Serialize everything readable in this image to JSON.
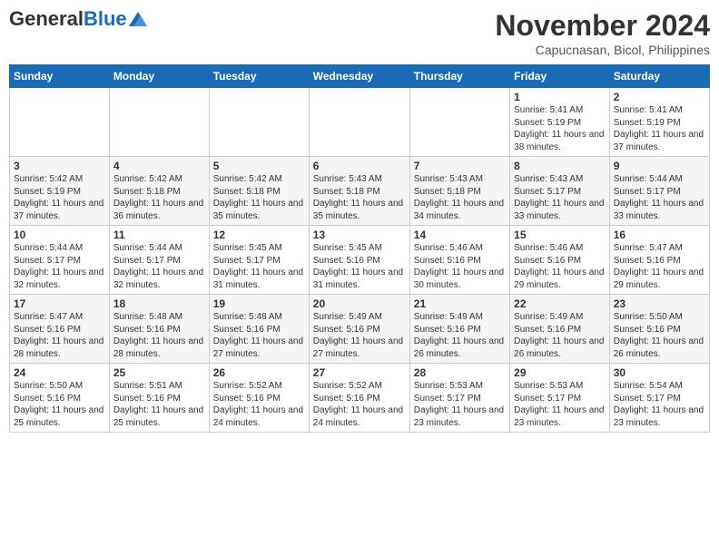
{
  "logo": {
    "general": "General",
    "blue": "Blue"
  },
  "title": "November 2024",
  "subtitle": "Capucnasan, Bicol, Philippines",
  "headers": [
    "Sunday",
    "Monday",
    "Tuesday",
    "Wednesday",
    "Thursday",
    "Friday",
    "Saturday"
  ],
  "weeks": [
    [
      {
        "day": "",
        "info": ""
      },
      {
        "day": "",
        "info": ""
      },
      {
        "day": "",
        "info": ""
      },
      {
        "day": "",
        "info": ""
      },
      {
        "day": "",
        "info": ""
      },
      {
        "day": "1",
        "info": "Sunrise: 5:41 AM\nSunset: 5:19 PM\nDaylight: 11 hours and 38 minutes."
      },
      {
        "day": "2",
        "info": "Sunrise: 5:41 AM\nSunset: 5:19 PM\nDaylight: 11 hours and 37 minutes."
      }
    ],
    [
      {
        "day": "3",
        "info": "Sunrise: 5:42 AM\nSunset: 5:19 PM\nDaylight: 11 hours and 37 minutes."
      },
      {
        "day": "4",
        "info": "Sunrise: 5:42 AM\nSunset: 5:18 PM\nDaylight: 11 hours and 36 minutes."
      },
      {
        "day": "5",
        "info": "Sunrise: 5:42 AM\nSunset: 5:18 PM\nDaylight: 11 hours and 35 minutes."
      },
      {
        "day": "6",
        "info": "Sunrise: 5:43 AM\nSunset: 5:18 PM\nDaylight: 11 hours and 35 minutes."
      },
      {
        "day": "7",
        "info": "Sunrise: 5:43 AM\nSunset: 5:18 PM\nDaylight: 11 hours and 34 minutes."
      },
      {
        "day": "8",
        "info": "Sunrise: 5:43 AM\nSunset: 5:17 PM\nDaylight: 11 hours and 33 minutes."
      },
      {
        "day": "9",
        "info": "Sunrise: 5:44 AM\nSunset: 5:17 PM\nDaylight: 11 hours and 33 minutes."
      }
    ],
    [
      {
        "day": "10",
        "info": "Sunrise: 5:44 AM\nSunset: 5:17 PM\nDaylight: 11 hours and 32 minutes."
      },
      {
        "day": "11",
        "info": "Sunrise: 5:44 AM\nSunset: 5:17 PM\nDaylight: 11 hours and 32 minutes."
      },
      {
        "day": "12",
        "info": "Sunrise: 5:45 AM\nSunset: 5:17 PM\nDaylight: 11 hours and 31 minutes."
      },
      {
        "day": "13",
        "info": "Sunrise: 5:45 AM\nSunset: 5:16 PM\nDaylight: 11 hours and 31 minutes."
      },
      {
        "day": "14",
        "info": "Sunrise: 5:46 AM\nSunset: 5:16 PM\nDaylight: 11 hours and 30 minutes."
      },
      {
        "day": "15",
        "info": "Sunrise: 5:46 AM\nSunset: 5:16 PM\nDaylight: 11 hours and 29 minutes."
      },
      {
        "day": "16",
        "info": "Sunrise: 5:47 AM\nSunset: 5:16 PM\nDaylight: 11 hours and 29 minutes."
      }
    ],
    [
      {
        "day": "17",
        "info": "Sunrise: 5:47 AM\nSunset: 5:16 PM\nDaylight: 11 hours and 28 minutes."
      },
      {
        "day": "18",
        "info": "Sunrise: 5:48 AM\nSunset: 5:16 PM\nDaylight: 11 hours and 28 minutes."
      },
      {
        "day": "19",
        "info": "Sunrise: 5:48 AM\nSunset: 5:16 PM\nDaylight: 11 hours and 27 minutes."
      },
      {
        "day": "20",
        "info": "Sunrise: 5:49 AM\nSunset: 5:16 PM\nDaylight: 11 hours and 27 minutes."
      },
      {
        "day": "21",
        "info": "Sunrise: 5:49 AM\nSunset: 5:16 PM\nDaylight: 11 hours and 26 minutes."
      },
      {
        "day": "22",
        "info": "Sunrise: 5:49 AM\nSunset: 5:16 PM\nDaylight: 11 hours and 26 minutes."
      },
      {
        "day": "23",
        "info": "Sunrise: 5:50 AM\nSunset: 5:16 PM\nDaylight: 11 hours and 26 minutes."
      }
    ],
    [
      {
        "day": "24",
        "info": "Sunrise: 5:50 AM\nSunset: 5:16 PM\nDaylight: 11 hours and 25 minutes."
      },
      {
        "day": "25",
        "info": "Sunrise: 5:51 AM\nSunset: 5:16 PM\nDaylight: 11 hours and 25 minutes."
      },
      {
        "day": "26",
        "info": "Sunrise: 5:52 AM\nSunset: 5:16 PM\nDaylight: 11 hours and 24 minutes."
      },
      {
        "day": "27",
        "info": "Sunrise: 5:52 AM\nSunset: 5:16 PM\nDaylight: 11 hours and 24 minutes."
      },
      {
        "day": "28",
        "info": "Sunrise: 5:53 AM\nSunset: 5:17 PM\nDaylight: 11 hours and 23 minutes."
      },
      {
        "day": "29",
        "info": "Sunrise: 5:53 AM\nSunset: 5:17 PM\nDaylight: 11 hours and 23 minutes."
      },
      {
        "day": "30",
        "info": "Sunrise: 5:54 AM\nSunset: 5:17 PM\nDaylight: 11 hours and 23 minutes."
      }
    ]
  ]
}
